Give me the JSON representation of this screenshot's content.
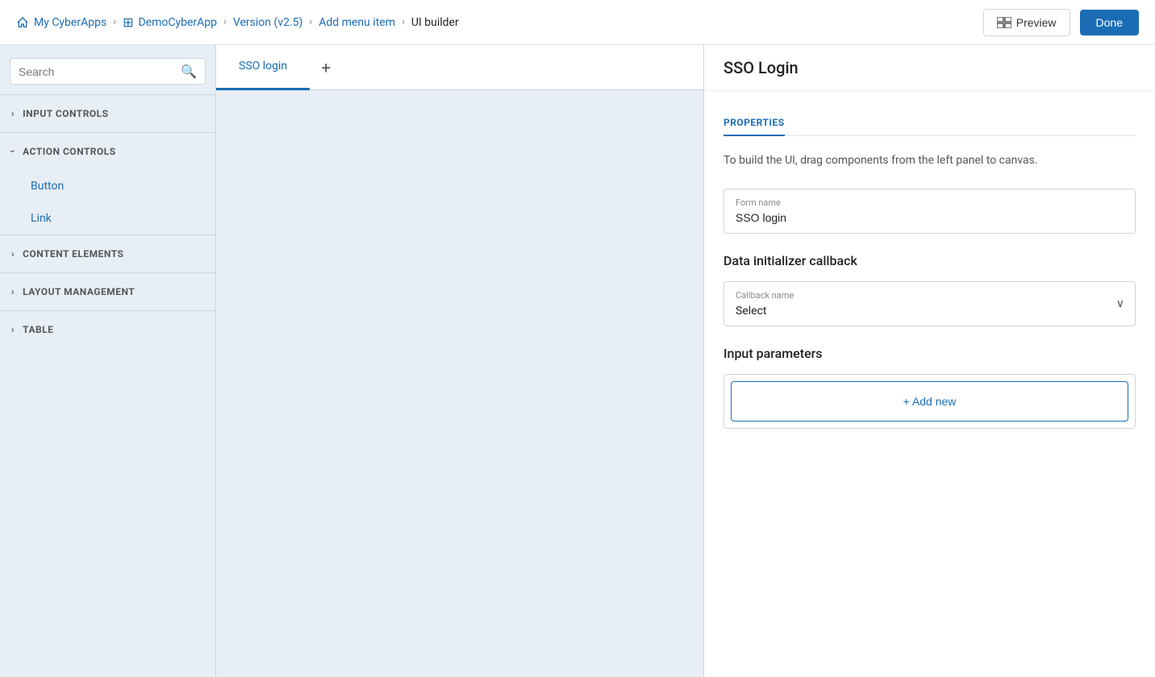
{
  "topnav": {
    "home_label": "My CyberApps",
    "app_label": "DemoCyberApp",
    "version_label": "Version (v2.5)",
    "menu_label": "Add menu item",
    "current_label": "UI builder"
  },
  "search": {
    "placeholder": "Search",
    "value": ""
  },
  "sidebar": {
    "sections": [
      {
        "id": "input-controls",
        "label": "INPUT CONTROLS",
        "expanded": false,
        "items": []
      },
      {
        "id": "action-controls",
        "label": "ACTION CONTROLS",
        "expanded": true,
        "items": [
          {
            "label": "Button"
          },
          {
            "label": "Link"
          }
        ]
      },
      {
        "id": "content-elements",
        "label": "CONTENT ELEMENTS",
        "expanded": false,
        "items": []
      },
      {
        "id": "layout-management",
        "label": "LAYOUT MANAGEMENT",
        "expanded": false,
        "items": []
      },
      {
        "id": "table",
        "label": "TABLE",
        "expanded": false,
        "items": []
      }
    ]
  },
  "canvas": {
    "tab_label": "SSO login",
    "add_tab_label": "+"
  },
  "right_panel": {
    "title": "SSO Login",
    "preview_label": "Preview",
    "done_label": "Done",
    "properties_tab": "PROPERTIES",
    "help_text": "To build the UI, drag components from the left panel to canvas.",
    "form_name_label": "Form name",
    "form_name_value": "SSO login",
    "data_initializer_label": "Data initializer callback",
    "callback_label": "Callback name",
    "callback_value": "Select",
    "input_params_label": "Input parameters",
    "add_new_label": "+ Add new"
  }
}
